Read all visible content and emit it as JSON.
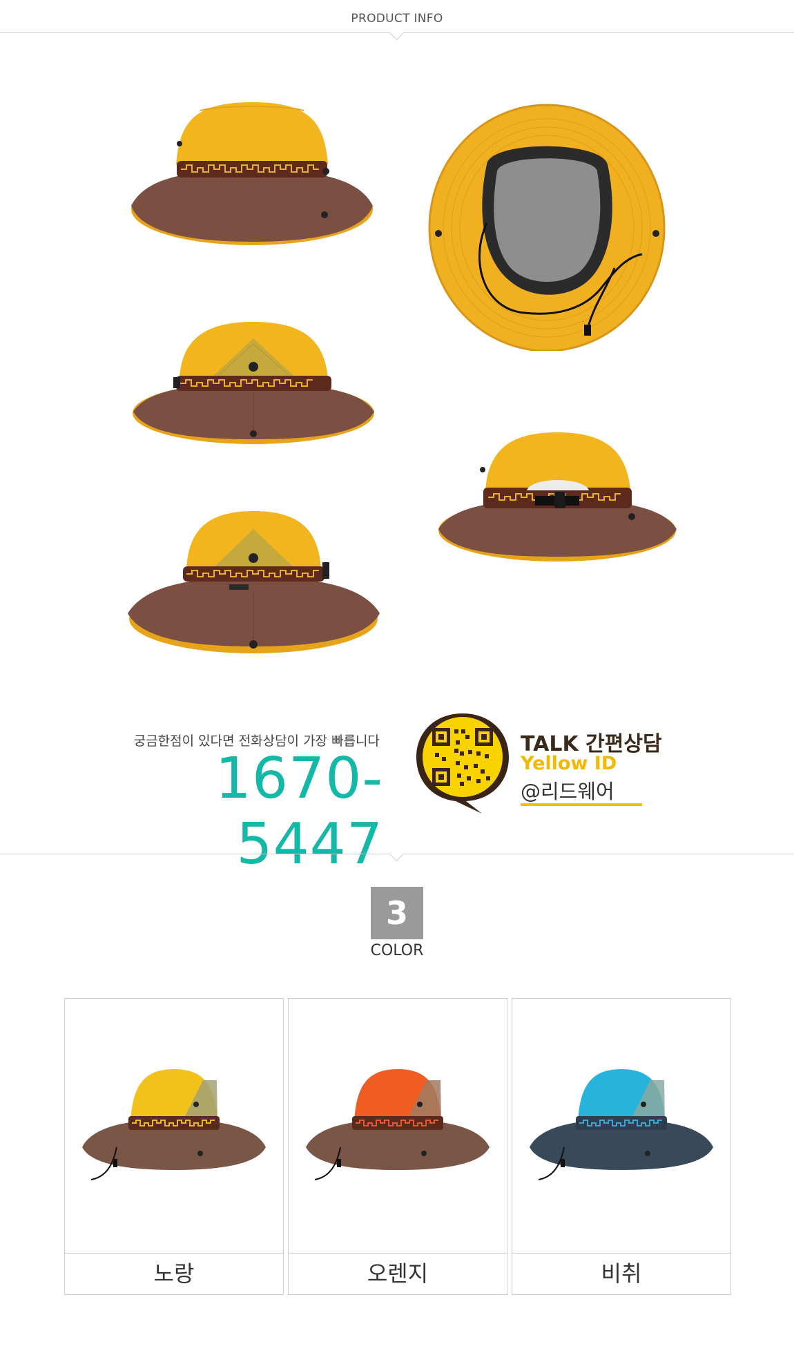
{
  "header": {
    "title": "PRODUCT INFO"
  },
  "contact": {
    "question": "궁금한점이 있다면 전화상담이 가장 빠릅니다",
    "phone": "1670-5447",
    "kakao_talk": "TALK 간편상담",
    "kakao_yellow_id": "Yellow ID",
    "kakao_id": "@리드웨어"
  },
  "colors_section": {
    "count": "3",
    "label": "COLOR",
    "options": [
      {
        "name": "노랑",
        "crown": "#f2c21c",
        "brim": "#7a5646",
        "band": "#5a2a1c",
        "pattern": "#e9b82a"
      },
      {
        "name": "오렌지",
        "crown": "#f05d23",
        "brim": "#7a5646",
        "band": "#5a2a1c",
        "pattern": "#e9572a"
      },
      {
        "name": "비취",
        "crown": "#27b3dc",
        "brim": "#38495a",
        "band": "#2f3e4e",
        "pattern": "#3aa7d6"
      }
    ]
  },
  "palette": {
    "accent_phone": "#14b8a6",
    "kakao_yellow": "#f3c100",
    "hat_yellow": "#f2b51d",
    "hat_brown": "#7b4f41"
  }
}
